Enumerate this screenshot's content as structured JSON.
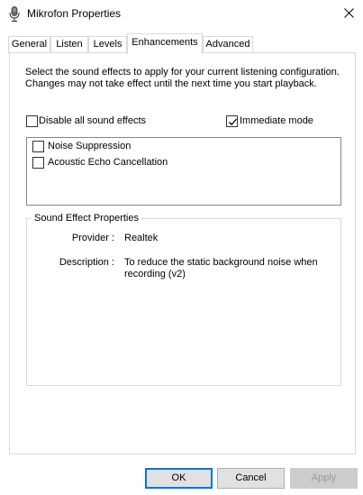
{
  "window": {
    "title": "Mikrofon Properties",
    "icon": "microphone-icon",
    "close_icon": "close-icon"
  },
  "tabs": [
    {
      "label": "General",
      "active": false
    },
    {
      "label": "Listen",
      "active": false
    },
    {
      "label": "Levels",
      "active": false
    },
    {
      "label": "Enhancements",
      "active": true
    },
    {
      "label": "Advanced",
      "active": false
    }
  ],
  "enhancements": {
    "description": "Select the sound effects to apply for your current listening configuration. Changes may not take effect until the next time you start playback.",
    "disable_all": {
      "label": "Disable all sound effects",
      "checked": false
    },
    "immediate_mode": {
      "label": "Immediate mode",
      "checked": true
    },
    "effects": [
      {
        "label": "Noise Suppression",
        "checked": false
      },
      {
        "label": "Acoustic Echo Cancellation",
        "checked": false
      }
    ],
    "properties": {
      "group_title": "Sound Effect Properties",
      "provider_label": "Provider :",
      "provider_value": "Realtek",
      "description_label": "Description :",
      "description_value": "To reduce the static background noise when recording (v2)"
    }
  },
  "buttons": {
    "ok": "OK",
    "cancel": "Cancel",
    "apply": "Apply"
  },
  "colors": {
    "accent": "#0078d7",
    "disabled_text": "#9b9b9b"
  }
}
